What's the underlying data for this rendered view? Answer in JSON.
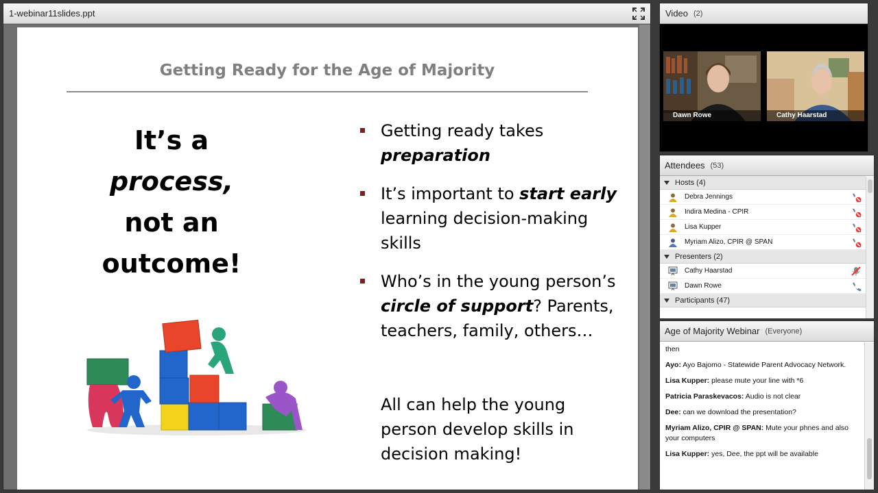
{
  "share_pod": {
    "filename": "1-webinar11slides.ppt",
    "slide": {
      "title": "Getting Ready for the Age of Majority",
      "tagline": {
        "line1": "It’s a",
        "line2": "process,",
        "line3": "not an",
        "line4": "outcome!"
      },
      "bullets": [
        {
          "a": "Getting ready takes ",
          "b": "preparation",
          "c": ""
        },
        {
          "a": "It’s important to ",
          "b": "start early",
          "c": " learning decision-making skills"
        },
        {
          "a": "Who’s in the young person’s ",
          "b": "circle of support",
          "c": "? Parents, teachers, family, others…"
        }
      ],
      "closing": "All can help the young person develop skills in decision making!",
      "bullet_color": "#8b1a1a"
    }
  },
  "video_pod": {
    "title": "Video",
    "count": "(2)",
    "feeds": [
      {
        "name": "Dawn Rowe"
      },
      {
        "name": "Cathy Haarstad"
      }
    ]
  },
  "attendees_pod": {
    "title": "Attendees",
    "count": "(53)",
    "hosts_label": "Hosts (4)",
    "hosts": [
      {
        "name": "Debra  Jennings",
        "icon": "host-icon",
        "status": "phone-muted-icon"
      },
      {
        "name": "Indira Medina - CPIR",
        "icon": "host-icon",
        "status": "phone-muted-icon"
      },
      {
        "name": "Lisa Kupper",
        "icon": "host-icon",
        "status": "phone-muted-icon"
      },
      {
        "name": "Myriam Alizo, CPIR @ SPAN",
        "icon": "host-icon",
        "status": "phone-muted-icon"
      }
    ],
    "presenters_label": "Presenters (2)",
    "presenters": [
      {
        "name": "Cathy Haarstad",
        "icon": "presenter-icon",
        "status": "mic-muted-icon"
      },
      {
        "name": "Dawn Rowe",
        "icon": "presenter-icon",
        "status": "phone-icon"
      }
    ],
    "participants_label": "Participants (47)"
  },
  "chat_pod": {
    "title": "Age of Majority Webinar",
    "scope": "(Everyone)",
    "messages": [
      {
        "who": "",
        "text": "then"
      },
      {
        "who": "Ayo:",
        "text": " Ayo Bajomo - Statewide Parent Advocacy Network."
      },
      {
        "who": "Lisa Kupper:",
        "text": " please mute your line with *6"
      },
      {
        "who": "Patricia Paraskevacos:",
        "text": " Audio is not clear"
      },
      {
        "who": "Dee:",
        "text": " can we download the presentation?"
      },
      {
        "who": "Myriam Alizo, CPIR @ SPAN:",
        "text": " Mute your phnes and also your computers"
      },
      {
        "who": "Lisa Kupper:",
        "text": " yes, Dee, the ppt will be available"
      }
    ]
  }
}
